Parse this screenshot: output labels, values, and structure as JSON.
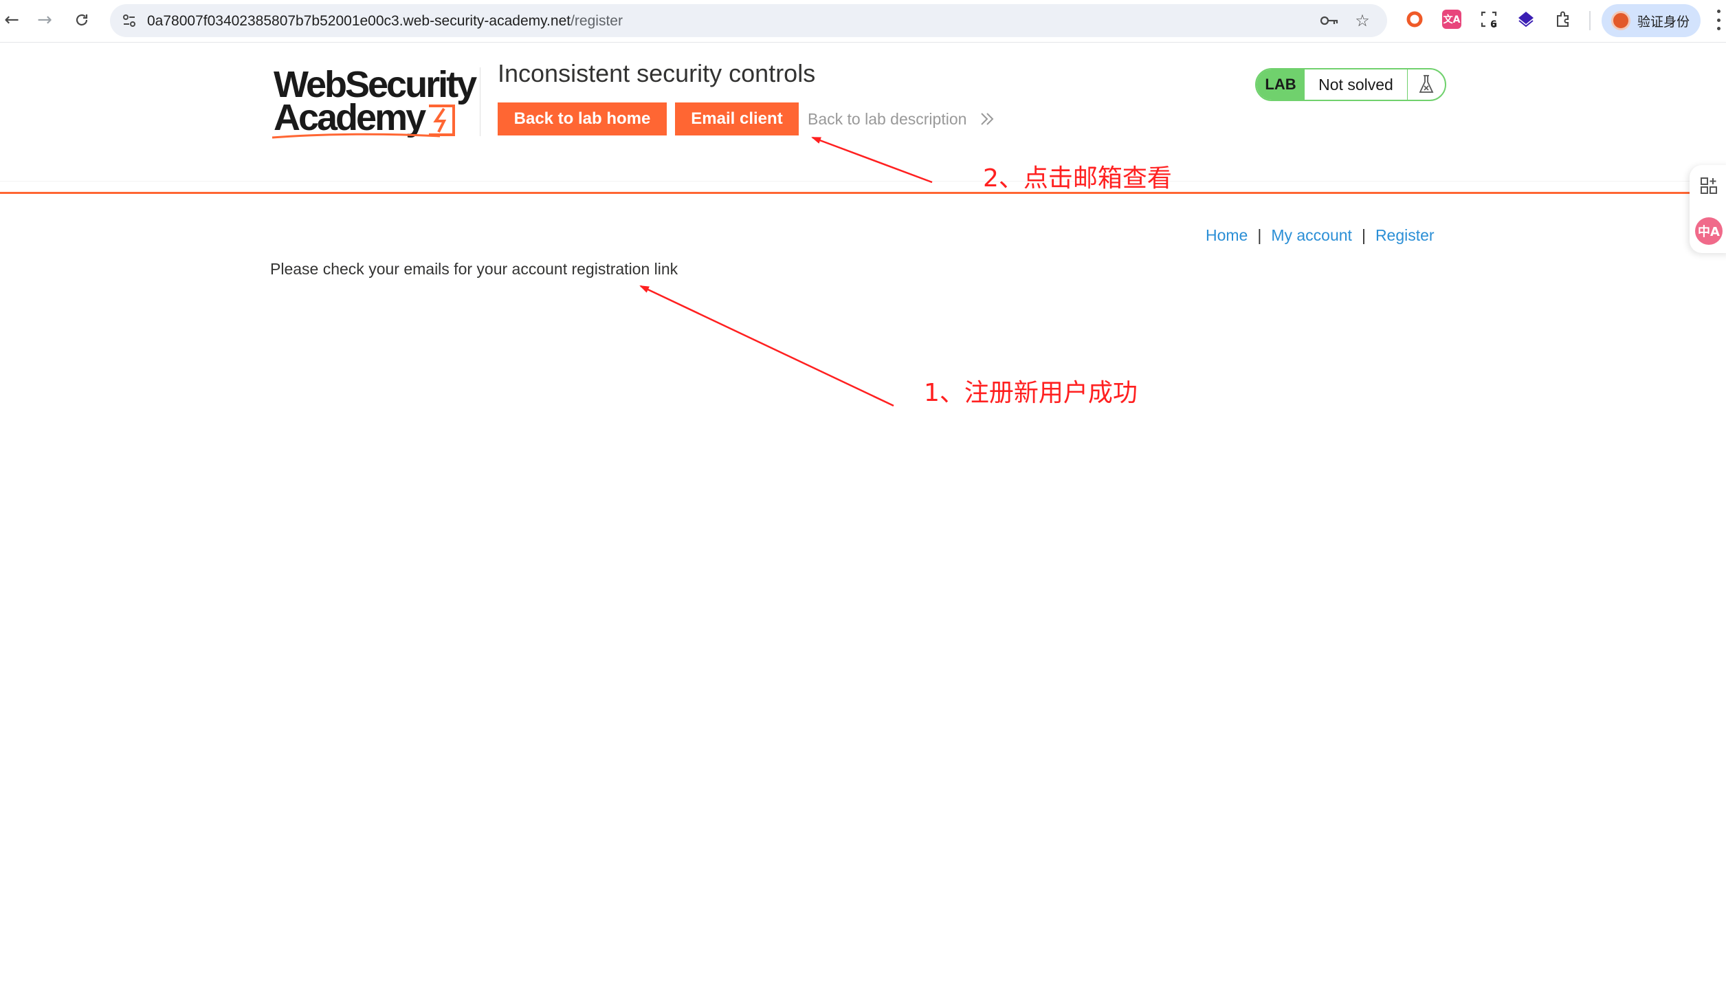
{
  "browser": {
    "url_host": "0a78007f03402385807b7b52001e00c3.web-security-academy.net",
    "url_path": "/register",
    "profile_label": "验证身份",
    "extension_badge": "6"
  },
  "header": {
    "logo_line1": "WebSecurity",
    "logo_line2": "Academy",
    "lab_title": "Inconsistent security controls",
    "back_to_lab_home": "Back to lab home",
    "email_client": "Email client",
    "back_to_lab_description": "Back to lab description",
    "lab_tag": "LAB",
    "lab_status": "Not solved"
  },
  "nav": {
    "home": "Home",
    "my_account": "My account",
    "register": "Register",
    "separator": "|"
  },
  "content": {
    "message": "Please check your emails for your account registration link"
  },
  "annotations": {
    "note_email": "2、点击邮箱查看",
    "note_registered": "1、注册新用户成功",
    "color": "#ff2020"
  },
  "colors": {
    "accent": "#ff6633",
    "lab_green": "#70d16d",
    "link": "#2b8fd6"
  }
}
